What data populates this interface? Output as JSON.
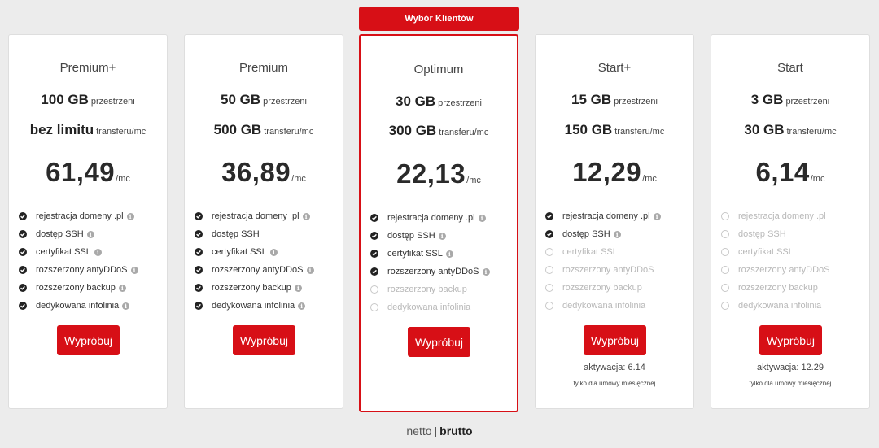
{
  "badge": "Wybór Klientów",
  "button_label": "Wypróbuj",
  "colors": {
    "accent": "#d70f16",
    "feature_on": "#222222",
    "feature_off": "#b8b8b8"
  },
  "plans": [
    {
      "name": "Premium+",
      "storage": {
        "value": "100 GB",
        "unit": "przestrzeni"
      },
      "transfer": {
        "value": "bez limitu",
        "unit": "transferu/mc"
      },
      "price": {
        "amount": "61,49",
        "unit": "/mc"
      },
      "features": [
        {
          "label": "rejestracja domeny .pl",
          "enabled": true,
          "info": true
        },
        {
          "label": "dostęp SSH",
          "enabled": true,
          "info": true
        },
        {
          "label": "certyfikat SSL",
          "enabled": true,
          "info": true
        },
        {
          "label": "rozszerzony antyDDoS",
          "enabled": true,
          "info": true
        },
        {
          "label": "rozszerzony backup",
          "enabled": true,
          "info": true
        },
        {
          "label": "dedykowana infolinia",
          "enabled": true,
          "info": true
        }
      ]
    },
    {
      "name": "Premium",
      "storage": {
        "value": "50 GB",
        "unit": "przestrzeni"
      },
      "transfer": {
        "value": "500 GB",
        "unit": "transferu/mc"
      },
      "price": {
        "amount": "36,89",
        "unit": "/mc"
      },
      "features": [
        {
          "label": "rejestracja domeny .pl",
          "enabled": true,
          "info": true
        },
        {
          "label": "dostęp SSH",
          "enabled": true,
          "info": false
        },
        {
          "label": "certyfikat SSL",
          "enabled": true,
          "info": true
        },
        {
          "label": "rozszerzony antyDDoS",
          "enabled": true,
          "info": true
        },
        {
          "label": "rozszerzony backup",
          "enabled": true,
          "info": true
        },
        {
          "label": "dedykowana infolinia",
          "enabled": true,
          "info": true
        }
      ]
    },
    {
      "name": "Optimum",
      "storage": {
        "value": "30 GB",
        "unit": "przestrzeni"
      },
      "transfer": {
        "value": "300 GB",
        "unit": "transferu/mc"
      },
      "price": {
        "amount": "22,13",
        "unit": "/mc"
      },
      "features": [
        {
          "label": "rejestracja domeny .pl",
          "enabled": true,
          "info": true
        },
        {
          "label": "dostęp SSH",
          "enabled": true,
          "info": true
        },
        {
          "label": "certyfikat SSL",
          "enabled": true,
          "info": true
        },
        {
          "label": "rozszerzony antyDDoS",
          "enabled": true,
          "info": true
        },
        {
          "label": "rozszerzony backup",
          "enabled": false,
          "info": false
        },
        {
          "label": "dedykowana infolinia",
          "enabled": false,
          "info": false
        }
      ]
    },
    {
      "name": "Start+",
      "storage": {
        "value": "15 GB",
        "unit": "przestrzeni"
      },
      "transfer": {
        "value": "150 GB",
        "unit": "transferu/mc"
      },
      "price": {
        "amount": "12,29",
        "unit": "/mc"
      },
      "activation": "aktywacja: 6.14",
      "note": "tylko dla umowy miesięcznej",
      "features": [
        {
          "label": "rejestracja domeny .pl",
          "enabled": true,
          "info": true
        },
        {
          "label": "dostęp SSH",
          "enabled": true,
          "info": true
        },
        {
          "label": "certyfikat SSL",
          "enabled": false,
          "info": false
        },
        {
          "label": "rozszerzony antyDDoS",
          "enabled": false,
          "info": false
        },
        {
          "label": "rozszerzony backup",
          "enabled": false,
          "info": false
        },
        {
          "label": "dedykowana infolinia",
          "enabled": false,
          "info": false
        }
      ]
    },
    {
      "name": "Start",
      "storage": {
        "value": "3 GB",
        "unit": "przestrzeni"
      },
      "transfer": {
        "value": "30 GB",
        "unit": "transferu/mc"
      },
      "price": {
        "amount": "6,14",
        "unit": "/mc"
      },
      "activation": "aktywacja: 12.29",
      "note": "tylko dla umowy miesięcznej",
      "features": [
        {
          "label": "rejestracja domeny .pl",
          "enabled": false,
          "info": false
        },
        {
          "label": "dostęp SSH",
          "enabled": false,
          "info": false
        },
        {
          "label": "certyfikat SSL",
          "enabled": false,
          "info": false
        },
        {
          "label": "rozszerzony antyDDoS",
          "enabled": false,
          "info": false
        },
        {
          "label": "rozszerzony backup",
          "enabled": false,
          "info": false
        },
        {
          "label": "dedykowana infolinia",
          "enabled": false,
          "info": false
        }
      ]
    }
  ],
  "tax_toggle": {
    "netto": "netto",
    "separator": "|",
    "brutto": "brutto"
  }
}
